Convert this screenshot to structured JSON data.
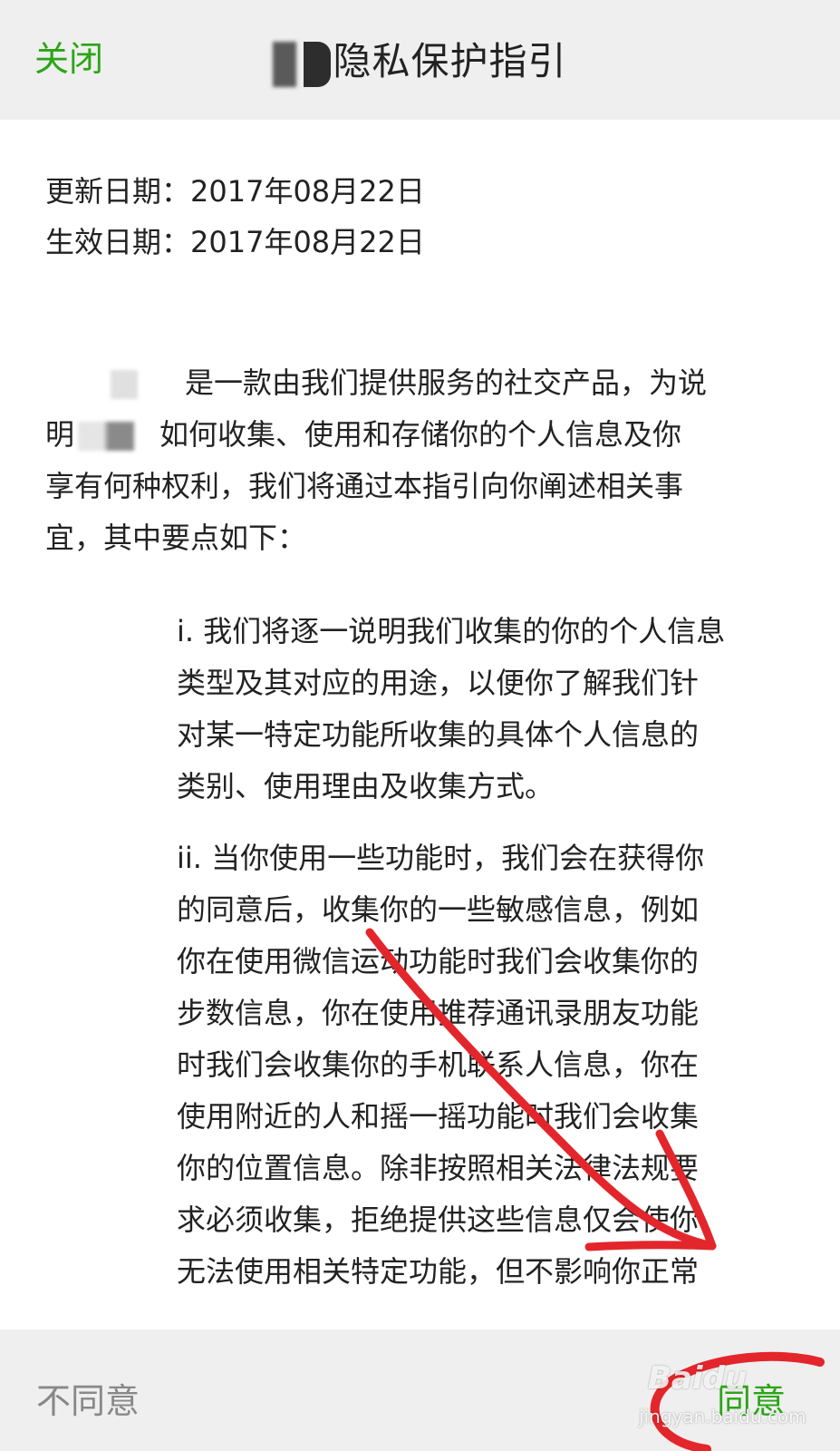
{
  "header": {
    "close_label": "关闭",
    "title": "隐私保护指引"
  },
  "dates": {
    "updated": "更新日期：2017年08月22日",
    "effective": "生效日期：2017年08月22日"
  },
  "intro": {
    "line1": "是一款由我们提供服务的社交产品，为说",
    "line2_prefix": "明",
    "line2_rest": "如何收集、使用和存储你的个人信息及你",
    "line3": "享有何种权利，我们将通过本指引向你阐述相关事",
    "line4": "宜，其中要点如下："
  },
  "points": [
    {
      "lines": [
        "i. 我们将逐一说明我们收集的你的个人信息",
        "类型及其对应的用途，以便你了解我们针",
        "对某一特定功能所收集的具体个人信息的",
        "类别、使用理由及收集方式。"
      ]
    },
    {
      "lines": [
        "ii. 当你使用一些功能时，我们会在获得你",
        "的同意后，收集你的一些敏感信息，例如",
        "你在使用微信运动功能时我们会收集你的",
        "步数信息，你在使用推荐通讯录朋友功能",
        "时我们会收集你的手机联系人信息，你在",
        "使用附近的人和摇一摇功能时我们会收集",
        "你的位置信息。除非按照相关法律法规要",
        "求必须收集，拒绝提供这些信息仅会使你",
        "无法使用相关特定功能，但不影响你正常"
      ]
    }
  ],
  "footer": {
    "disagree_label": "不同意",
    "agree_label": "同意"
  },
  "watermark": {
    "brand": "Baidu",
    "url": "jingyan.baidu.com"
  },
  "colors": {
    "accent_green": "#2aa515",
    "bar_background": "#efefef",
    "annotation_red": "#e3262b"
  }
}
